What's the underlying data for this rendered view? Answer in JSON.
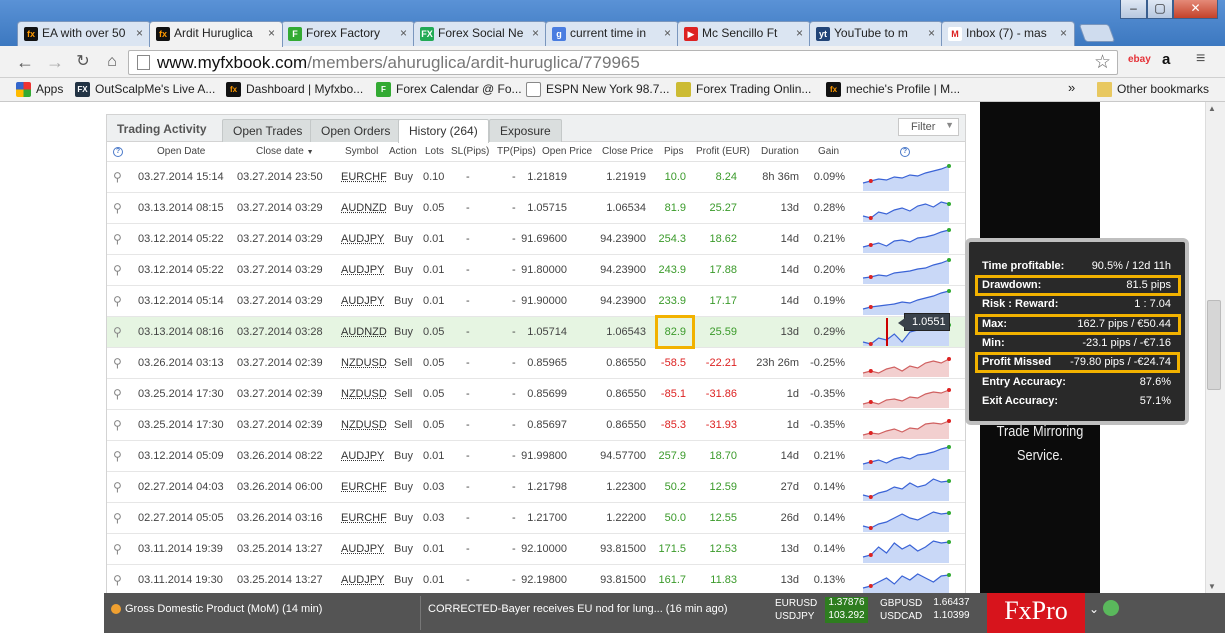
{
  "browser": {
    "tabs": [
      {
        "label": "EA with over 50",
        "fav": "fx",
        "active": false
      },
      {
        "label": "Ardit Huruglica",
        "fav": "fx",
        "active": true
      },
      {
        "label": "Forex Factory",
        "fav": "ff",
        "active": false
      },
      {
        "label": "Forex Social Ne",
        "fav": "fxs",
        "active": false
      },
      {
        "label": "current time in",
        "fav": "google",
        "active": false
      },
      {
        "label": "Mc Sencillo Ft",
        "fav": "youtube",
        "active": false
      },
      {
        "label": "YouTube to m",
        "fav": "mp3",
        "active": false
      },
      {
        "label": "Inbox (7) - mas",
        "fav": "gmail",
        "active": false
      }
    ],
    "url_domain": "www.myfxbook.com",
    "url_path": "/members/ahuruglica/ardit-huruglica/779965",
    "extensions": {
      "ebay": "ebay",
      "amazon": "a"
    },
    "bookmarks": [
      {
        "label": "Apps"
      },
      {
        "label": "OutScalpMe's Live A..."
      },
      {
        "label": "Dashboard | Myfxbo..."
      },
      {
        "label": "Forex Calendar @ Fo..."
      },
      {
        "label": "ESPN New York 98.7..."
      },
      {
        "label": "Forex Trading Onlin..."
      },
      {
        "label": "mechie's Profile | M..."
      }
    ],
    "bookmarks_overflow": "»",
    "other_bookmarks": "Other bookmarks"
  },
  "panel": {
    "title": "Trading Activity",
    "tabs": [
      "Open Trades",
      "Open Orders",
      "History (264)",
      "Exposure"
    ],
    "active_tab": 2,
    "filter_label": "Filter",
    "columns": {
      "open_date": "Open Date",
      "close_date": "Close date",
      "symbol": "Symbol",
      "action": "Action",
      "lots": "Lots",
      "sl": "SL(Pips)",
      "tp": "TP(Pips)",
      "open_price": "Open Price",
      "close_price": "Close Price",
      "pips": "Pips",
      "profit": "Profit (EUR)",
      "duration": "Duration",
      "gain": "Gain"
    },
    "rows": [
      {
        "open": "03.27.2014 15:14",
        "close": "03.27.2014 23:50",
        "symbol": "EURCHF",
        "action": "Buy",
        "lots": "0.10",
        "sl": "-",
        "tp": "-",
        "op": "1.21819",
        "cp": "1.21919",
        "pips": "10.0",
        "profit": "8.24",
        "duration": "8h 36m",
        "gain": "0.09%",
        "positive": true
      },
      {
        "open": "03.13.2014 08:15",
        "close": "03.27.2014 03:29",
        "symbol": "AUDNZD",
        "action": "Buy",
        "lots": "0.05",
        "sl": "-",
        "tp": "-",
        "op": "1.05715",
        "cp": "1.06534",
        "pips": "81.9",
        "profit": "25.27",
        "duration": "13d",
        "gain": "0.28%",
        "positive": true
      },
      {
        "open": "03.12.2014 05:22",
        "close": "03.27.2014 03:29",
        "symbol": "AUDJPY",
        "action": "Buy",
        "lots": "0.01",
        "sl": "-",
        "tp": "-",
        "op": "91.69600",
        "cp": "94.23900",
        "pips": "254.3",
        "profit": "18.62",
        "duration": "14d",
        "gain": "0.21%",
        "positive": true
      },
      {
        "open": "03.12.2014 05:22",
        "close": "03.27.2014 03:29",
        "symbol": "AUDJPY",
        "action": "Buy",
        "lots": "0.01",
        "sl": "-",
        "tp": "-",
        "op": "91.80000",
        "cp": "94.23900",
        "pips": "243.9",
        "profit": "17.88",
        "duration": "14d",
        "gain": "0.20%",
        "positive": true
      },
      {
        "open": "03.12.2014 05:14",
        "close": "03.27.2014 03:29",
        "symbol": "AUDJPY",
        "action": "Buy",
        "lots": "0.01",
        "sl": "-",
        "tp": "-",
        "op": "91.90000",
        "cp": "94.23900",
        "pips": "233.9",
        "profit": "17.17",
        "duration": "14d",
        "gain": "0.19%",
        "positive": true
      },
      {
        "open": "03.13.2014 08:16",
        "close": "03.27.2014 03:28",
        "symbol": "AUDNZD",
        "action": "Buy",
        "lots": "0.05",
        "sl": "-",
        "tp": "-",
        "op": "1.05714",
        "cp": "1.06543",
        "pips": "82.9",
        "profit": "25.59",
        "duration": "13d",
        "gain": "0.29%",
        "positive": true,
        "highlight": true
      },
      {
        "open": "03.26.2014 03:13",
        "close": "03.27.2014 02:39",
        "symbol": "NZDUSD",
        "action": "Sell",
        "lots": "0.05",
        "sl": "-",
        "tp": "-",
        "op": "0.85965",
        "cp": "0.86550",
        "pips": "-58.5",
        "profit": "-22.21",
        "duration": "23h 26m",
        "gain": "-0.25%",
        "positive": false
      },
      {
        "open": "03.25.2014 17:30",
        "close": "03.27.2014 02:39",
        "symbol": "NZDUSD",
        "action": "Sell",
        "lots": "0.05",
        "sl": "-",
        "tp": "-",
        "op": "0.85699",
        "cp": "0.86550",
        "pips": "-85.1",
        "profit": "-31.86",
        "duration": "1d",
        "gain": "-0.35%",
        "positive": false
      },
      {
        "open": "03.25.2014 17:30",
        "close": "03.27.2014 02:39",
        "symbol": "NZDUSD",
        "action": "Sell",
        "lots": "0.05",
        "sl": "-",
        "tp": "-",
        "op": "0.85697",
        "cp": "0.86550",
        "pips": "-85.3",
        "profit": "-31.93",
        "duration": "1d",
        "gain": "-0.35%",
        "positive": false
      },
      {
        "open": "03.12.2014 05:09",
        "close": "03.26.2014 08:22",
        "symbol": "AUDJPY",
        "action": "Buy",
        "lots": "0.01",
        "sl": "-",
        "tp": "-",
        "op": "91.99800",
        "cp": "94.57700",
        "pips": "257.9",
        "profit": "18.70",
        "duration": "14d",
        "gain": "0.21%",
        "positive": true
      },
      {
        "open": "02.27.2014 04:03",
        "close": "03.26.2014 06:00",
        "symbol": "EURCHF",
        "action": "Buy",
        "lots": "0.03",
        "sl": "-",
        "tp": "-",
        "op": "1.21798",
        "cp": "1.22300",
        "pips": "50.2",
        "profit": "12.59",
        "duration": "27d",
        "gain": "0.14%",
        "positive": true
      },
      {
        "open": "02.27.2014 05:05",
        "close": "03.26.2014 03:16",
        "symbol": "EURCHF",
        "action": "Buy",
        "lots": "0.03",
        "sl": "-",
        "tp": "-",
        "op": "1.21700",
        "cp": "1.22200",
        "pips": "50.0",
        "profit": "12.55",
        "duration": "26d",
        "gain": "0.14%",
        "positive": true
      },
      {
        "open": "03.11.2014 19:39",
        "close": "03.25.2014 13:27",
        "symbol": "AUDJPY",
        "action": "Buy",
        "lots": "0.01",
        "sl": "-",
        "tp": "-",
        "op": "92.10000",
        "cp": "93.81500",
        "pips": "171.5",
        "profit": "12.53",
        "duration": "13d",
        "gain": "0.14%",
        "positive": true
      },
      {
        "open": "03.11.2014 19:30",
        "close": "03.25.2014 13:27",
        "symbol": "AUDJPY",
        "action": "Buy",
        "lots": "0.01",
        "sl": "-",
        "tp": "-",
        "op": "92.19800",
        "cp": "93.81500",
        "pips": "161.7",
        "profit": "11.83",
        "duration": "13d",
        "gain": "0.13%",
        "positive": true
      }
    ],
    "hover_price": "1.0551"
  },
  "tooltip": {
    "items": [
      {
        "label": "Time profitable:",
        "value": "90.5% / 12d 11h",
        "boxed": false
      },
      {
        "label": "Drawdown:",
        "value": "81.5 pips",
        "boxed": true
      },
      {
        "label": "Risk : Reward:",
        "value": "1 : 7.04",
        "boxed": false
      },
      {
        "label": "Max:",
        "value": "162.7 pips / €50.44",
        "boxed": true
      },
      {
        "label": "Min:",
        "value": "-23.1 pips / -€7.16",
        "boxed": false
      },
      {
        "label": "Profit Missed",
        "value": "-79.80 pips / -€24.74",
        "boxed": true
      },
      {
        "label": "Entry Accuracy:",
        "value": "87.6%",
        "boxed": false
      },
      {
        "label": "Exit Accuracy:",
        "value": "57.1%",
        "boxed": false
      }
    ]
  },
  "ad": {
    "line1": "Trade Mirroring",
    "line2": "Service."
  },
  "ticker": {
    "news1": "Gross Domestic Product (MoM) (14 min)",
    "news2": "CORRECTED-Bayer receives EU nod for lung...  (16 min ago)",
    "quotes": [
      {
        "pair": "EURUSD",
        "value": "1.37876",
        "up": true
      },
      {
        "pair": "USDJPY",
        "value": "103.292",
        "up": true
      },
      {
        "pair": "GBPUSD",
        "value": "1.66437",
        "up": null
      },
      {
        "pair": "USDCAD",
        "value": "1.10399",
        "up": null
      }
    ],
    "brand": "FxPro"
  },
  "colors": {
    "positive": "#3a9a2a",
    "negative": "#dd2222",
    "highlight_box": "#f2b200",
    "chrome_blue": "#3c78c0",
    "fxpro_red": "#d7141c"
  }
}
